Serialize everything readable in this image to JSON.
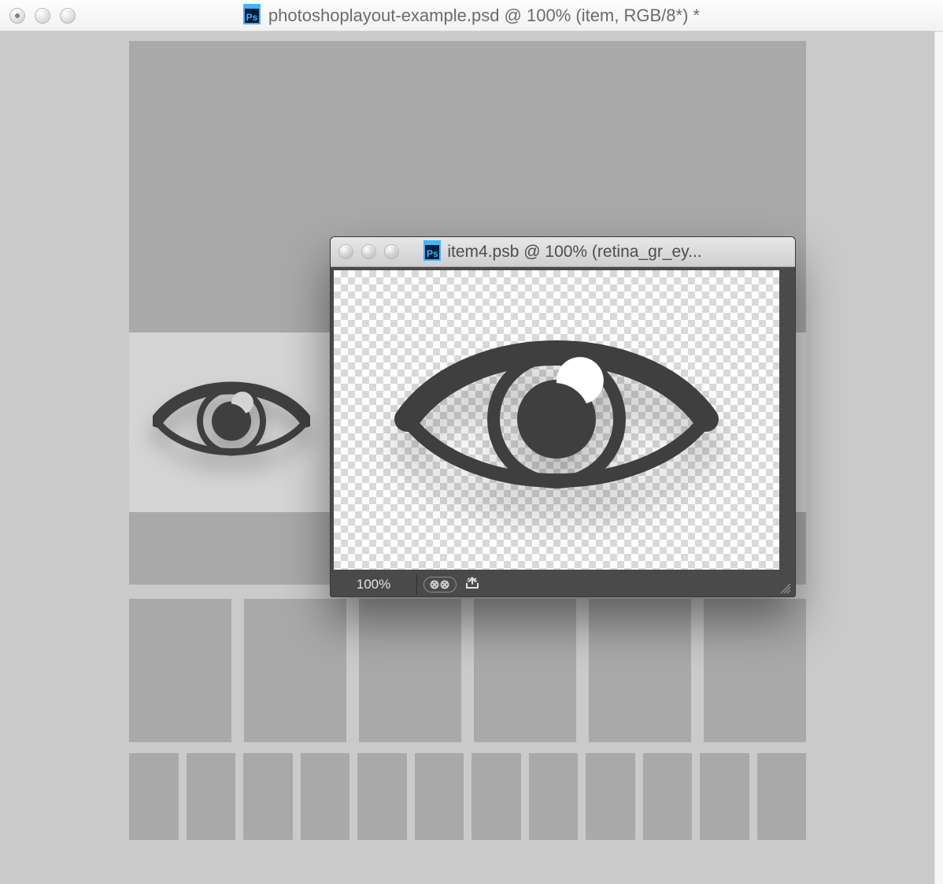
{
  "main_window": {
    "title": "photoshoplayout-example.psd @ 100% (item, RGB/8*) *",
    "ps_badge": "Ps"
  },
  "float_window": {
    "title": "item4.psb @ 100% (retina_gr_ey...",
    "ps_badge": "Ps",
    "zoom": "100%"
  }
}
